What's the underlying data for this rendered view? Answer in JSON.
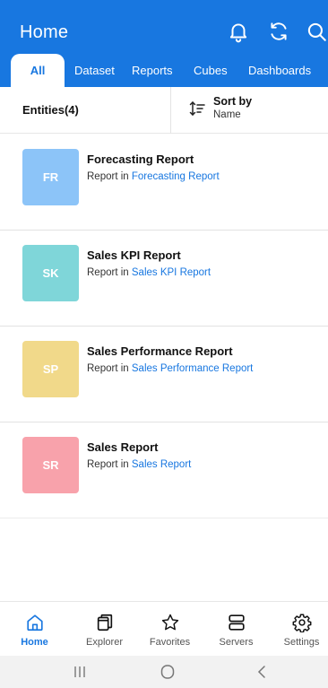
{
  "header": {
    "title": "Home",
    "icons": [
      "bell-icon",
      "refresh-icon",
      "search-icon"
    ]
  },
  "tabs": [
    {
      "label": "All",
      "active": true
    },
    {
      "label": "Dataset",
      "active": false
    },
    {
      "label": "Reports",
      "active": false
    },
    {
      "label": "Cubes",
      "active": false
    },
    {
      "label": "Dashboards",
      "active": false
    }
  ],
  "toolbar": {
    "entities_label": "Entities(4)",
    "sort_label": "Sort by",
    "sort_value": "Name",
    "sort_icon": "sort-icon"
  },
  "entities": [
    {
      "initials": "FR",
      "title": "Forecasting Report",
      "prefix": "Report in",
      "location": "Forecasting Report",
      "color": "#8cc4f8"
    },
    {
      "initials": "SK",
      "title": "Sales KPI Report",
      "prefix": "Report in",
      "location": "Sales KPI Report",
      "color": "#7fd6d9"
    },
    {
      "initials": "SP",
      "title": "Sales Performance Report",
      "prefix": "Report in",
      "location": "Sales Performance Report",
      "color": "#f1d98a"
    },
    {
      "initials": "SR",
      "title": "Sales Report",
      "prefix": "Report in",
      "location": "Sales Report",
      "color": "#f8a2ab"
    }
  ],
  "bottom_nav": [
    {
      "label": "Home",
      "icon": "home-icon",
      "active": true
    },
    {
      "label": "Explorer",
      "icon": "explorer-icon",
      "active": false
    },
    {
      "label": "Favorites",
      "icon": "star-icon",
      "active": false
    },
    {
      "label": "Servers",
      "icon": "servers-icon",
      "active": false
    },
    {
      "label": "Settings",
      "icon": "settings-icon",
      "active": false
    }
  ],
  "system_nav": [
    "recent-apps-icon",
    "home-circle-icon",
    "back-icon"
  ],
  "colors": {
    "primary": "#1877e0",
    "text": "#111111",
    "link": "#1877e0",
    "system_bar": "#f2f2f2"
  }
}
